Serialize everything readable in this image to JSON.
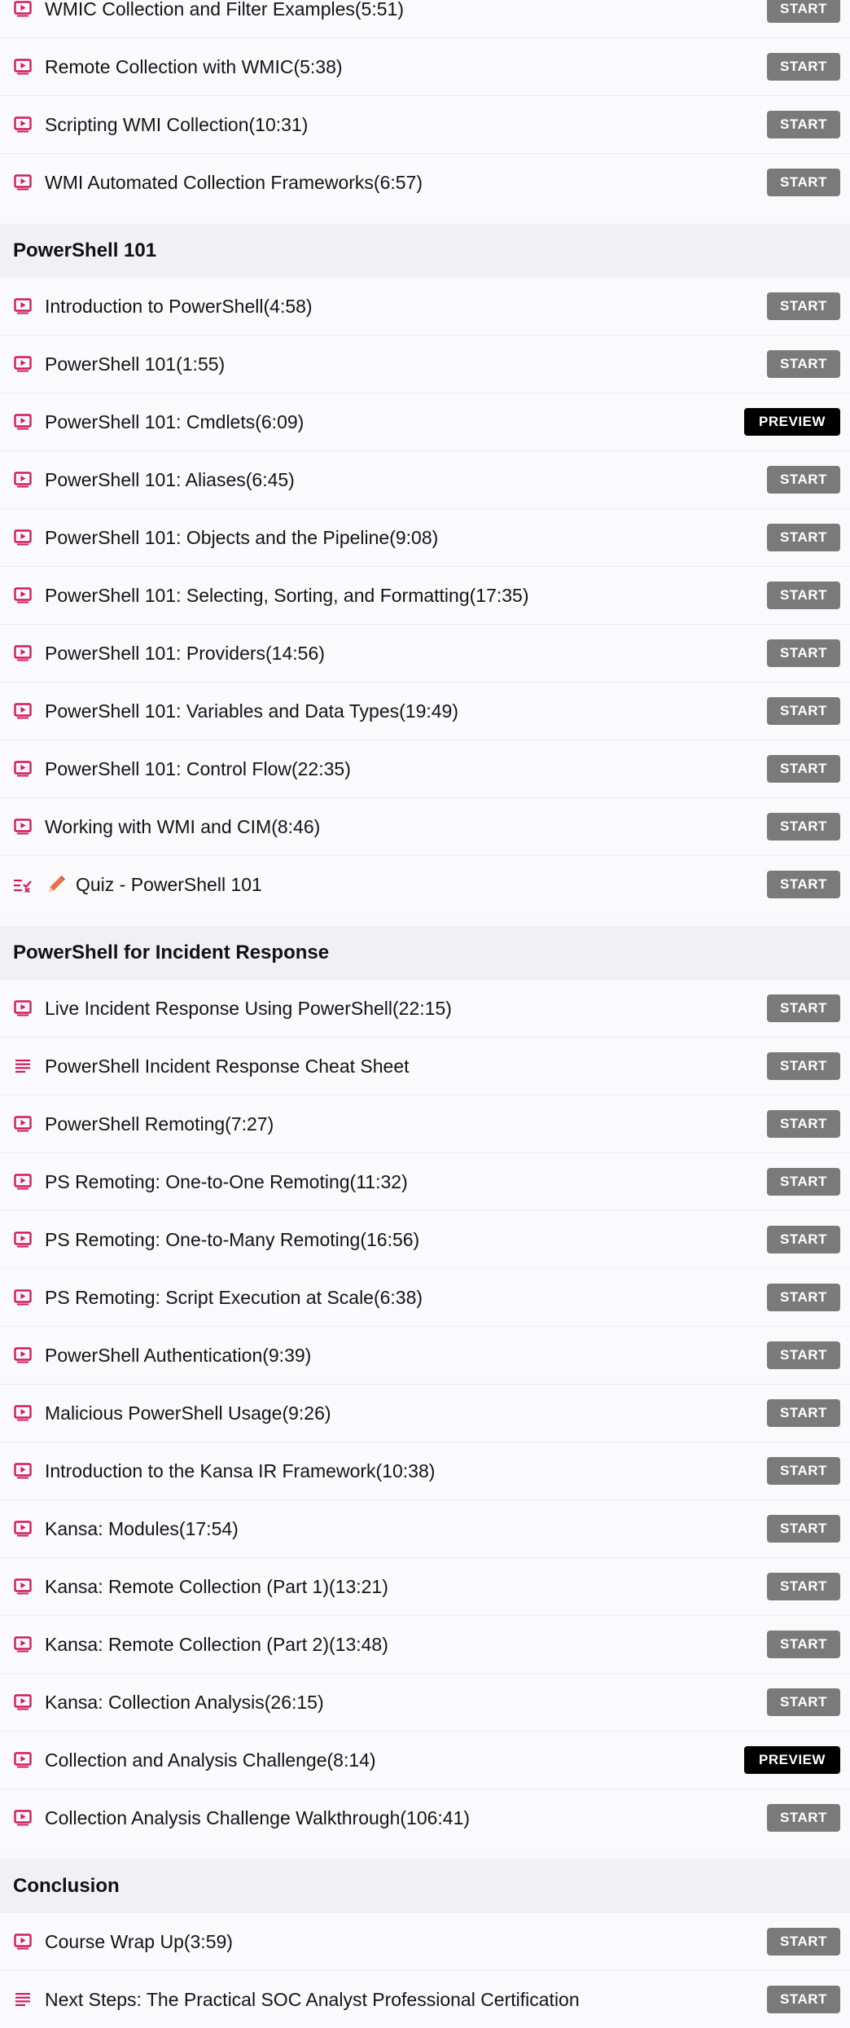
{
  "colors": {
    "accent_icon": "#d3195f",
    "start_button": "#7a7a7a",
    "preview_button": "#000000",
    "section_header_bg": "#f0f0f5",
    "pencil": "#e8724a"
  },
  "labels": {
    "start": "START",
    "preview": "PREVIEW"
  },
  "sections": [
    {
      "title": "",
      "lessons": [
        {
          "type": "video",
          "title": "WMIC Collection and Filter Examples(5:51)",
          "action": "start"
        },
        {
          "type": "video",
          "title": "Remote Collection with WMIC(5:38)",
          "action": "start"
        },
        {
          "type": "video",
          "title": "Scripting WMI Collection(10:31)",
          "action": "start"
        },
        {
          "type": "video",
          "title": "WMI Automated Collection Frameworks(6:57)",
          "action": "start"
        }
      ]
    },
    {
      "title": "PowerShell 101",
      "lessons": [
        {
          "type": "video",
          "title": "Introduction to PowerShell(4:58)",
          "action": "start"
        },
        {
          "type": "video",
          "title": "PowerShell 101(1:55)",
          "action": "start"
        },
        {
          "type": "video",
          "title": "PowerShell 101: Cmdlets(6:09)",
          "action": "preview"
        },
        {
          "type": "video",
          "title": "PowerShell 101: Aliases(6:45)",
          "action": "start"
        },
        {
          "type": "video",
          "title": "PowerShell 101: Objects and the Pipeline(9:08)",
          "action": "start"
        },
        {
          "type": "video",
          "title": "PowerShell 101: Selecting, Sorting, and Formatting(17:35)",
          "action": "start"
        },
        {
          "type": "video",
          "title": "PowerShell 101: Providers(14:56)",
          "action": "start"
        },
        {
          "type": "video",
          "title": "PowerShell 101: Variables and Data Types(19:49)",
          "action": "start"
        },
        {
          "type": "video",
          "title": "PowerShell 101: Control Flow(22:35)",
          "action": "start"
        },
        {
          "type": "video",
          "title": "Working with WMI and CIM(8:46)",
          "action": "start"
        },
        {
          "type": "quiz",
          "title": "Quiz - PowerShell 101",
          "action": "start"
        }
      ]
    },
    {
      "title": "PowerShell for Incident Response",
      "lessons": [
        {
          "type": "video",
          "title": "Live Incident Response Using PowerShell(22:15)",
          "action": "start"
        },
        {
          "type": "text",
          "title": "PowerShell Incident Response Cheat Sheet",
          "action": "start"
        },
        {
          "type": "video",
          "title": "PowerShell Remoting(7:27)",
          "action": "start"
        },
        {
          "type": "video",
          "title": "PS Remoting: One-to-One Remoting(11:32)",
          "action": "start"
        },
        {
          "type": "video",
          "title": "PS Remoting: One-to-Many Remoting(16:56)",
          "action": "start"
        },
        {
          "type": "video",
          "title": "PS Remoting: Script Execution at Scale(6:38)",
          "action": "start"
        },
        {
          "type": "video",
          "title": "PowerShell Authentication(9:39)",
          "action": "start"
        },
        {
          "type": "video",
          "title": "Malicious PowerShell Usage(9:26)",
          "action": "start"
        },
        {
          "type": "video",
          "title": "Introduction to the Kansa IR Framework(10:38)",
          "action": "start"
        },
        {
          "type": "video",
          "title": "Kansa: Modules(17:54)",
          "action": "start"
        },
        {
          "type": "video",
          "title": "Kansa: Remote Collection (Part 1)(13:21)",
          "action": "start"
        },
        {
          "type": "video",
          "title": "Kansa: Remote Collection (Part 2)(13:48)",
          "action": "start"
        },
        {
          "type": "video",
          "title": "Kansa: Collection Analysis(26:15)",
          "action": "start"
        },
        {
          "type": "video",
          "title": "Collection and Analysis Challenge(8:14)",
          "action": "preview"
        },
        {
          "type": "video",
          "title": "Collection Analysis Challenge Walkthrough(106:41)",
          "action": "start"
        }
      ]
    },
    {
      "title": "Conclusion",
      "lessons": [
        {
          "type": "video",
          "title": "Course Wrap Up(3:59)",
          "action": "start"
        },
        {
          "type": "text",
          "title": "Next Steps: The Practical SOC Analyst Professional Certification",
          "action": "start"
        }
      ]
    }
  ]
}
